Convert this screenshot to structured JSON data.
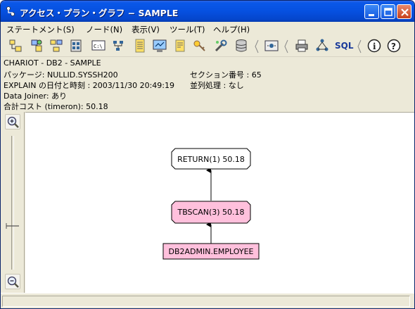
{
  "window": {
    "title": "アクセス・プラン・グラフ − SAMPLE"
  },
  "menubar": {
    "items": [
      {
        "label": "ステートメント(S)"
      },
      {
        "label": "ノード(N)"
      },
      {
        "label": "表示(V)"
      },
      {
        "label": "ツール(T)"
      },
      {
        "label": "ヘルプ(H)"
      }
    ]
  },
  "toolbar": {
    "sql_label": "SQL"
  },
  "info": {
    "line1": "CHARIOT - DB2 - SAMPLE",
    "package": "パッケージ: NULLID.SYSSH200",
    "section": "セクション番号 : 65",
    "explain_datetime": "EXPLAIN の日付と時刻 : 2003/11/30 20:49:19",
    "parallel": "並列処理 : なし",
    "data_joiner": "Data Joiner: あり",
    "total_cost": "合計コスト (timeron): 50.18"
  },
  "graph": {
    "nodes": [
      {
        "label": "RETURN(1) 50.18",
        "type": "operator",
        "fill": "#ffffff"
      },
      {
        "label": "TBSCAN(3) 50.18",
        "type": "operator",
        "fill": "#ffc0dc"
      },
      {
        "label": "DB2ADMIN.EMPLOYEE",
        "type": "table",
        "fill": "#ffc0dc"
      }
    ]
  },
  "colors": {
    "titlebar": "#0650e0",
    "node_pink": "#ffc0dc",
    "canvas": "#ffffff"
  },
  "icons": [
    "app-icon",
    "minimize-icon",
    "maximize-icon",
    "close-icon",
    "zoom-in-icon",
    "zoom-out-icon",
    "info-icon",
    "help-icon",
    "print-icon"
  ]
}
